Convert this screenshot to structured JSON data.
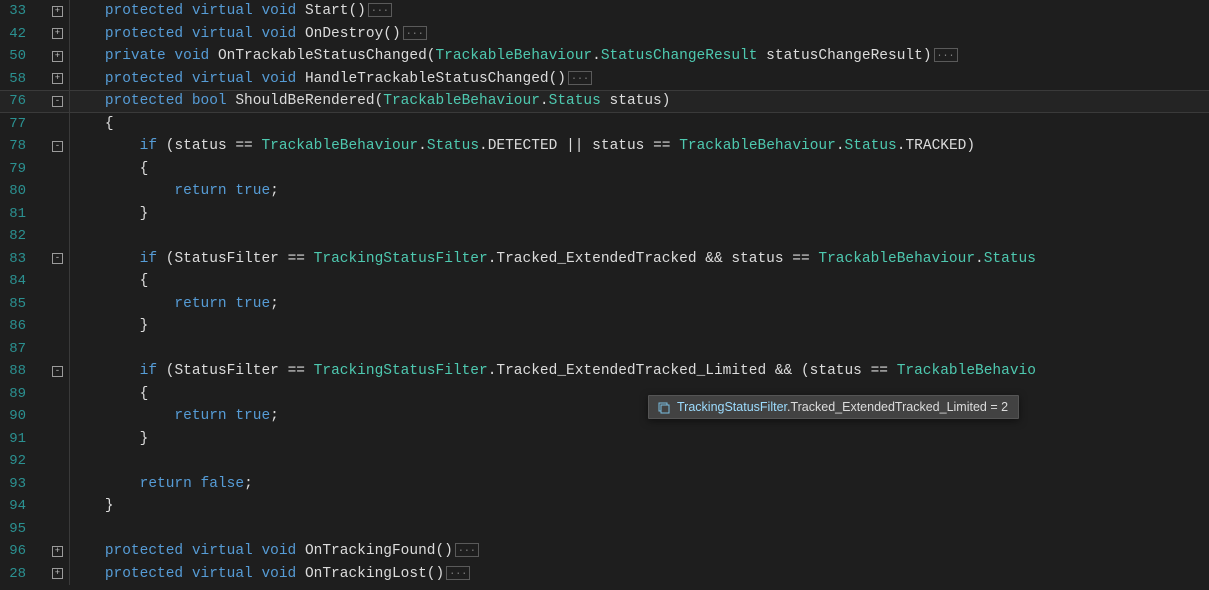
{
  "lines": {
    "l1": {
      "num": "33",
      "fold": "+",
      "mods": "protected virtual void",
      "name": "Start"
    },
    "l2": {
      "num": "42",
      "fold": "+",
      "mods": "protected virtual void",
      "name": "OnDestroy"
    },
    "l3": {
      "num": "50",
      "fold": "+",
      "mods": "private void",
      "name": "OnTrackableStatusChanged",
      "ptype": "TrackableBehaviour",
      "pmember": "StatusChangeResult",
      "pname": "statusChangeResult"
    },
    "l4": {
      "num": "58",
      "fold": "+",
      "mods": "protected virtual void",
      "name": "HandleTrackableStatusChanged"
    },
    "l5": {
      "num": "76",
      "fold": "-",
      "mods": "protected bool",
      "name": "ShouldBeRendered",
      "ptype": "TrackableBehaviour",
      "pmember": "Status",
      "pname": "status"
    },
    "l6": {
      "num": "77",
      "brace": "{"
    },
    "l7": {
      "num": "78",
      "fold": "-",
      "kw": "if",
      "a1": "status",
      "t1": "TrackableBehaviour",
      "m1": "Status",
      "e1": "DETECTED",
      "op": "||",
      "a2": "status",
      "t2": "TrackableBehaviour",
      "m2": "Status",
      "e2": "TRACKED"
    },
    "l8": {
      "num": "79",
      "brace": "{"
    },
    "l9": {
      "num": "80",
      "kw": "return",
      "val": "true"
    },
    "l10": {
      "num": "81",
      "brace": "}"
    },
    "l11": {
      "num": "82"
    },
    "l12": {
      "num": "83",
      "fold": "-",
      "kw": "if",
      "a1": "StatusFilter",
      "t1": "TrackingStatusFilter",
      "e1": "Tracked_ExtendedTracked",
      "op": "&&",
      "a2": "status",
      "t2": "TrackableBehaviour",
      "m2": "Status"
    },
    "l13": {
      "num": "84",
      "brace": "{"
    },
    "l14": {
      "num": "85",
      "kw": "return",
      "val": "true"
    },
    "l15": {
      "num": "86",
      "brace": "}"
    },
    "l16": {
      "num": "87"
    },
    "l17": {
      "num": "88",
      "fold": "-",
      "kw": "if",
      "a1": "StatusFilter",
      "t1": "TrackingStatusFilter",
      "e1": "Tracked_ExtendedTracked_Limited",
      "op": "&&",
      "a2": "status",
      "t2": "TrackableBehavio"
    },
    "l18": {
      "num": "89",
      "brace": "{"
    },
    "l19": {
      "num": "90",
      "kw": "return",
      "val": "true"
    },
    "l20": {
      "num": "91",
      "brace": "}"
    },
    "l21": {
      "num": "92"
    },
    "l22": {
      "num": "93",
      "kw": "return",
      "val": "false"
    },
    "l23": {
      "num": "94",
      "brace": "}"
    },
    "l24": {
      "num": "95"
    },
    "l25": {
      "num": "96",
      "fold": "+",
      "mods": "protected virtual void",
      "name": "OnTrackingFound"
    },
    "l26": {
      "num": "28",
      "fold": "+",
      "mods": "protected virtual void",
      "name": "OnTrackingLost"
    }
  },
  "tooltip": {
    "type_prefix": "TrackingStatusFilter",
    "member": ".Tracked_ExtendedTracked_Limited = 2"
  },
  "collapsed_marker": "..."
}
